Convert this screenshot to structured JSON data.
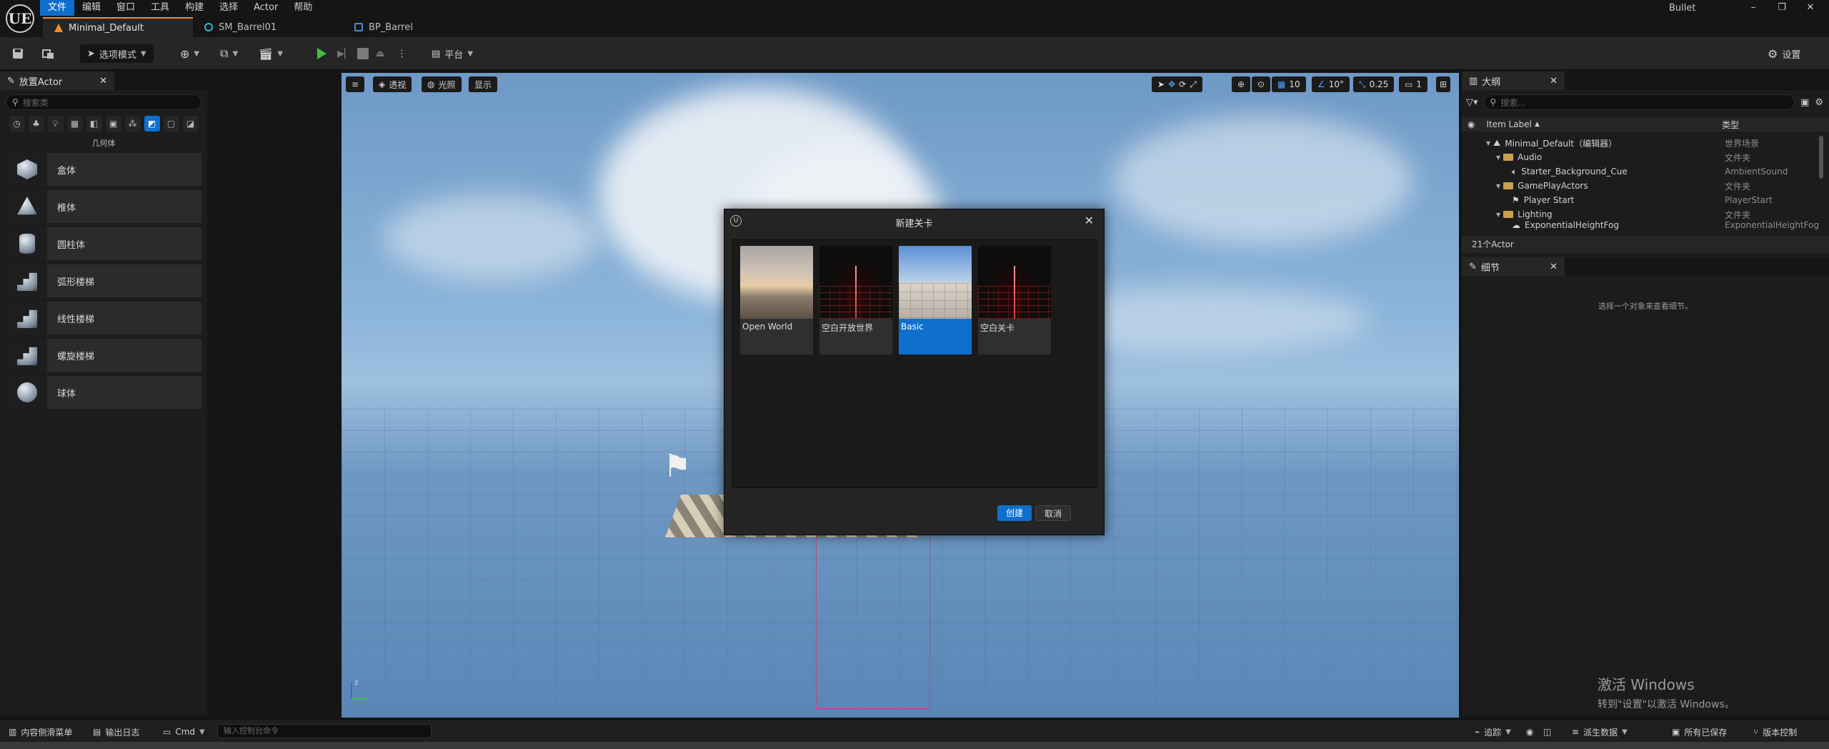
{
  "app": {
    "logo": "UE",
    "window_title": "Bullet",
    "menu": [
      "文件",
      "编辑",
      "窗口",
      "工具",
      "构建",
      "选择",
      "Actor",
      "帮助"
    ],
    "window_controls": {
      "minimize": "–",
      "restore": "❐",
      "close": "✕"
    }
  },
  "doc_tabs": [
    {
      "label": "Minimal_Default",
      "icon": "level-icon"
    },
    {
      "label": "SM_Barrel01",
      "icon": "static-mesh-icon"
    },
    {
      "label": "BP_Barrel",
      "icon": "blueprint-icon"
    }
  ],
  "toolbar": {
    "mode": "选项模式",
    "platform": "平台",
    "settings": "设置"
  },
  "place_actors": {
    "tab": "放置Actor",
    "search_placeholder": "搜索类",
    "category": "几何体",
    "items": [
      "盒体",
      "椎体",
      "圆柱体",
      "弧形楼梯",
      "线性楼梯",
      "螺旋楼梯",
      "球体"
    ]
  },
  "viewport": {
    "perspective": "透视",
    "lit": "光照",
    "show": "显示",
    "grid_snap": "10",
    "rot_snap": "10°",
    "scale_snap": "0.25",
    "camera_speed": "1"
  },
  "new_level_dialog": {
    "title": "新建关卡",
    "templates": [
      "Open World",
      "空白开放世界",
      "Basic",
      "空白关卡"
    ],
    "selected": "Basic",
    "create": "创建",
    "cancel": "取消"
  },
  "outliner": {
    "tab": "大纲",
    "search_placeholder": "搜索...",
    "col_label": "Item Label",
    "col_type": "类型",
    "rows": [
      {
        "label": "Minimal_Default（编辑器）",
        "type": "世界场景"
      },
      {
        "label": "Audio",
        "type": "文件夹"
      },
      {
        "label": "Starter_Background_Cue",
        "type": "AmbientSound"
      },
      {
        "label": "GamePlayActors",
        "type": "文件夹"
      },
      {
        "label": "Player Start",
        "type": "PlayerStart"
      },
      {
        "label": "Lighting",
        "type": "文件夹"
      },
      {
        "label": "ExponentialHeightFog",
        "type": "ExponentialHeightFog"
      }
    ],
    "count": "21个Actor"
  },
  "details": {
    "tab": "细节",
    "empty": "选择一个对象来查看细节。"
  },
  "watermark": {
    "line1": "激活 Windows",
    "line2": "转到\"设置\"以激活 Windows。"
  },
  "statusbar": {
    "content_drawer": "内容侧滑菜单",
    "output_log": "输出日志",
    "cmd": "Cmd",
    "cmd_placeholder": "输入控制台命令",
    "trace": "追踪",
    "derived_data": "派生数据",
    "all_saved": "所有已保存",
    "source_control": "版本控制"
  }
}
